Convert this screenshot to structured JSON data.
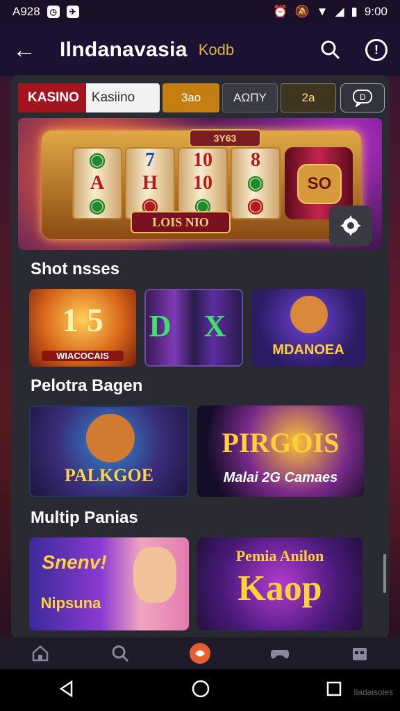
{
  "status_bar": {
    "left_text": "A928",
    "time": "9:00"
  },
  "app_bar": {
    "title": "Ilndanavasia",
    "badge": "Kodb"
  },
  "filters": {
    "kasino_bold": "KASINO",
    "kasino_text": "Kasiino",
    "chip_2": "3ao",
    "chip_3": "AΩΠY",
    "chip_4": "2a"
  },
  "banner": {
    "top_label": "3Y63",
    "machine_label": "LOIS NIO",
    "badge": "SO",
    "reel_symbols": [
      "A",
      "H",
      "10",
      "8"
    ]
  },
  "sections": [
    {
      "title": "Shot nsses",
      "tiles": [
        {
          "label": "1 5",
          "caption": "WIACOCAIS"
        },
        {
          "label": "D X",
          "caption": ""
        },
        {
          "label": "MDANOEA",
          "caption": ""
        }
      ]
    },
    {
      "title": "Pelotra Bagen",
      "tiles": [
        {
          "label": "PALKGOE",
          "caption": ""
        },
        {
          "label": "PIRGOIS",
          "caption": "Malai 2G Camaes"
        }
      ]
    },
    {
      "title": "Multip Panias",
      "tiles": [
        {
          "label": "Snenv!",
          "caption": "Nipsuna"
        },
        {
          "label": "Kaop",
          "caption": "Pemia Anilon"
        }
      ]
    }
  ],
  "watermark": "Iladaisoles",
  "colors": {
    "accent": "#e85f2f",
    "gold": "#c47e12",
    "card": "#2a2a33",
    "appbar": "#1b1130"
  },
  "icons": [
    "back-arrow-icon",
    "search-icon",
    "info-icon",
    "chat-icon",
    "settings-icon",
    "home-icon",
    "search-icon",
    "games-icon",
    "controller-icon",
    "calendar-icon",
    "back-triangle-icon",
    "home-circle-icon",
    "recents-square-icon"
  ]
}
